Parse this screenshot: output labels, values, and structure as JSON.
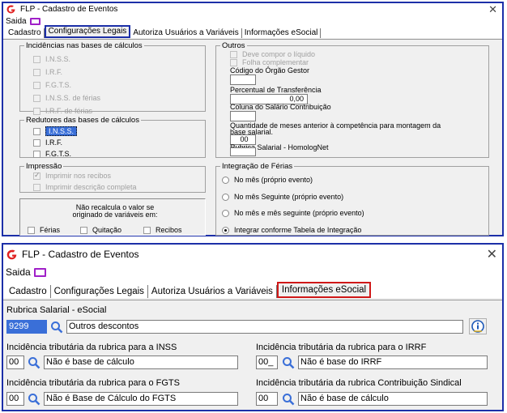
{
  "colors": {
    "highlight_blue": "#1c2fa8",
    "highlight_red": "#d01818",
    "selection": "#3a6fd8",
    "logo_red": "#e02020",
    "monitor_purple": "#a020c8"
  },
  "win1": {
    "title": "FLP - Cadastro de Eventos",
    "menu_saida": "Saida",
    "tabs": [
      "Cadastro",
      "Configurações Legais",
      "Autoriza Usuários a Variáveis",
      "Informações eSocial"
    ],
    "incidencias": {
      "legend": "Incidências nas bases de cálculos",
      "items": [
        "I.N.S.S.",
        "I.R.F.",
        "F.G.T.S.",
        "I.N.S.S. de férias",
        "I.R.F. de férias"
      ]
    },
    "redutores": {
      "legend": "Redutores das bases de cálculos",
      "items": [
        "I.N.S.S.",
        "I.R.F.",
        "F.G.T.S."
      ]
    },
    "impressao": {
      "legend": "Impressão",
      "items": [
        "Imprimir nos recibos",
        "Imprimir descrição completa"
      ]
    },
    "nao_recalcula": {
      "line1": "Não recalcula o valor se",
      "line2": "originado de variáveis em:",
      "items": [
        "Férias",
        "Quitação",
        "Recibos"
      ]
    },
    "outros": {
      "legend": "Outros",
      "chk_items": [
        "Deve compor o líquido",
        "Folha complementar"
      ],
      "codigo_orgao_label": "Código do Órgão Gestor",
      "codigo_orgao_value": "",
      "percentual_label": "Percentual de Transferência",
      "percentual_value": "0,00",
      "coluna_label": "Coluna do Salário Contribuição",
      "coluna_value": "",
      "quantidade_label_1": "Quantidade de meses anterior à competência para montagem da",
      "quantidade_label_2": "base salarial.",
      "quantidade_value": "00",
      "rubrica_label": "Rubrica Salarial - HomologNet",
      "rubrica_value": ""
    },
    "integracao": {
      "legend": "Integração de Férias",
      "options": [
        "No mês (próprio evento)",
        "No mês Seguinte (próprio evento)",
        "No mês e mês seguinte (próprio evento)",
        "Integrar conforme Tabela de Integração"
      ],
      "selected": 3
    }
  },
  "win2": {
    "title": "FLP - Cadastro de Eventos",
    "menu_saida": "Saida",
    "tabs": [
      "Cadastro",
      "Configurações Legais",
      "Autoriza Usuários a Variáveis",
      "Informações eSocial"
    ],
    "rubrica_label": "Rubrica Salarial - eSocial",
    "rubrica_code": "9299",
    "rubrica_desc": "Outros descontos",
    "inss_label": "Incidência tributária da rubrica para a INSS",
    "inss_code": "00",
    "inss_desc": "Não é base de cálculo",
    "irrf_label": "Incidência tributária da rubrica para o IRRF",
    "irrf_code": "00_",
    "irrf_desc": "Não é base do IRRF",
    "fgts_label": "Incidência tributária da rubrica para o FGTS",
    "fgts_code": "00",
    "fgts_desc": "Não é Base de Cálculo do FGTS",
    "sindical_label": "Incidência tributária da rubrica Contribuição Sindical",
    "sindical_code": "00",
    "sindical_desc": "Não é base de cálculo"
  }
}
